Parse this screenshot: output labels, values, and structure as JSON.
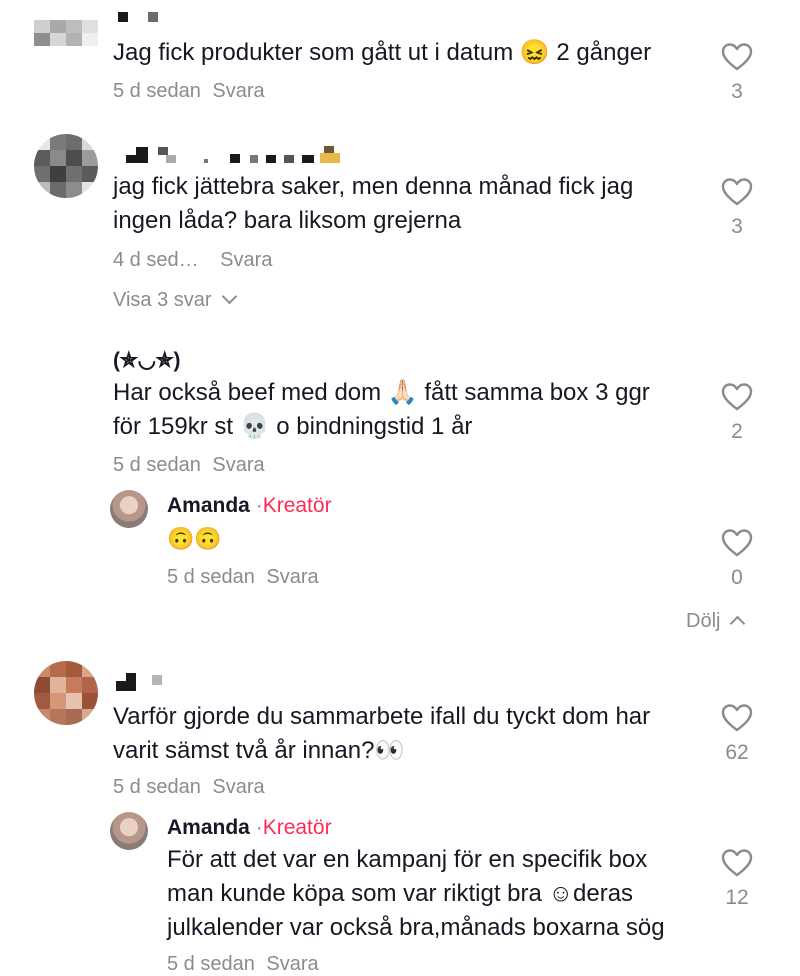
{
  "comments": [
    {
      "text": "Jag fick produkter som gått ut i datum 😖 2 gånger",
      "time": "5 d sedan",
      "reply": "Svara",
      "likes": "3"
    },
    {
      "text_line1": "jag fick jättebra saker, men denna månad fick jag",
      "text_line2": "ingen låda? bara liksom grejerna",
      "time": "4 d sed…",
      "reply": "Svara",
      "likes": "3",
      "view_replies": "Visa 3 svar"
    },
    {
      "username": "(✯◡✯)",
      "text_line1": "Har också beef med dom 🙏🏻 fått samma box 3 ggr",
      "text_line2": "för 159kr st 💀 o bindningstid 1 år",
      "time": "5 d sedan",
      "reply": "Svara",
      "likes": "2",
      "replies": [
        {
          "username": "Amanda",
          "separator": "·",
          "badge": "Kreatör",
          "text": "🙃🙃",
          "time": "5 d sedan",
          "reply": "Svara",
          "likes": "0"
        }
      ],
      "hide_label": "Dölj"
    },
    {
      "text_line1": "Varför gjorde du sammarbete ifall du tyckt dom har",
      "text_line2": "varit sämst två år innan?👀",
      "time": "5 d sedan",
      "reply": "Svara",
      "likes": "62",
      "replies": [
        {
          "username": "Amanda",
          "separator": "·",
          "badge": "Kreatör",
          "text_line1": "För att det var en kampanj för en specifik box",
          "text_line2": "man kunde köpa som var riktigt bra ☺deras",
          "text_line3": "julkalender var också bra,månads boxarna sög",
          "time": "5 d sedan",
          "reply": "Svara",
          "likes": "12"
        }
      ]
    }
  ],
  "colors": {
    "text": "#161823",
    "muted": "#8a8b91",
    "creator": "#fe2c55"
  },
  "icons": [
    "heart-icon",
    "chevron-down-icon",
    "chevron-up-icon"
  ]
}
